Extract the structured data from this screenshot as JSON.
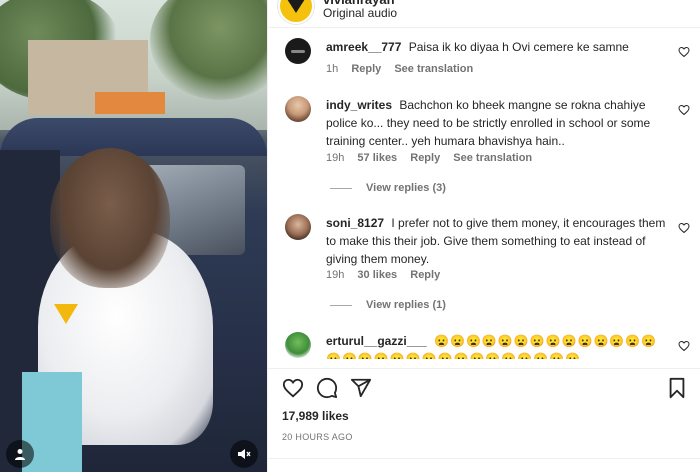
{
  "post": {
    "username": "vivianrayan",
    "audio_label": "Original audio",
    "verified_icon": "verified-badge-icon",
    "accent_color": "#0095f6"
  },
  "comments": [
    {
      "user": "amreek__777",
      "text": "Paisa ik ko diyaa h Ovi cemere ke samne",
      "time": "1h",
      "reply": "Reply",
      "translate": "See translation"
    },
    {
      "user": "indy_writes",
      "text": "Bachchon ko bheek mangne se rokna chahiye police ko... they need to be strictly enrolled in school or some training center.. yeh humara bhavishya hain..",
      "time": "19h",
      "likes": "57 likes",
      "reply": "Reply",
      "translate": "See translation",
      "view_replies": "View replies (3)"
    },
    {
      "user": "soni_8127",
      "text": "I prefer not to give them money, it encourages them to make this their job. Give them something to eat instead of giving them money.",
      "time": "19h",
      "likes": "30 likes",
      "reply": "Reply",
      "view_replies": "View replies (1)"
    },
    {
      "user": "erturul__gazzi___",
      "text": "😦😦😦😦😦😦😦😦😦😦😦😦😦😦😦😦😦😦😦😦😦😦😦😦😦😦😦😦😦😦"
    }
  ],
  "actions": {
    "like_icon": "heart-icon",
    "comment_icon": "comment-icon",
    "share_icon": "share-icon",
    "save_icon": "bookmark-icon"
  },
  "likes_count": "17,989 likes",
  "posted_time": "20 HOURS AGO"
}
